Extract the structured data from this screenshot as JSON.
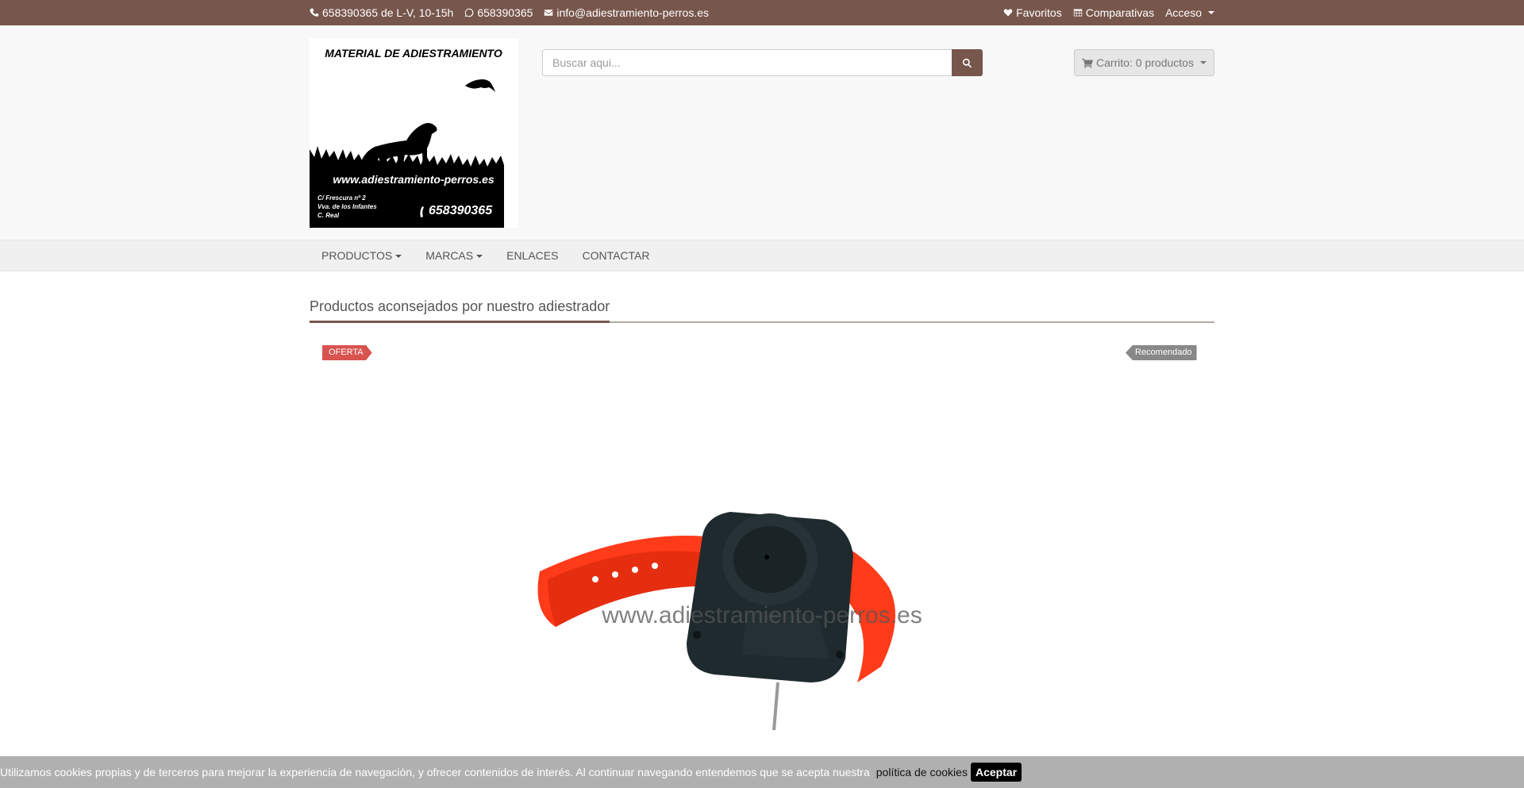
{
  "topbar": {
    "phone": "658390365 de L-V, 10-15h",
    "whatsapp": "658390365",
    "email": "info@adiestramiento-perros.es",
    "favorites": "Favoritos",
    "comparisons": "Comparativas",
    "access": "Acceso"
  },
  "logo": {
    "title": "MATERIAL DE ADIESTRAMIENTO",
    "website": "www.adiestramiento-perros.es",
    "address_line1": "C/ Frescura nº 2",
    "address_line2": "Vva. de los Infantes",
    "address_line3": "C. Real",
    "phone": "658390365"
  },
  "search": {
    "placeholder": "Buscar aqui..."
  },
  "cart": {
    "label": "Carrito: 0 productos"
  },
  "nav": {
    "items": [
      {
        "label": "PRODUCTOS",
        "dropdown": true
      },
      {
        "label": "MARCAS",
        "dropdown": true
      },
      {
        "label": "ENLACES",
        "dropdown": false
      },
      {
        "label": "CONTACTAR",
        "dropdown": false
      }
    ]
  },
  "section": {
    "title": "Productos aconsejados por nuestro adiestrador"
  },
  "product": {
    "badge_offer": "OFERTA",
    "badge_recommended": "Recomendado",
    "watermark": "www.adiestramiento-perros.es"
  },
  "cookie": {
    "text": "Utilizamos cookies propias y de terceros para mejorar la experiencia de navegación, y ofrecer contenidos de interés. Al continuar navegando entendemos que se acepta nuestra",
    "link": "política de cookies",
    "accept": "Aceptar"
  },
  "colors": {
    "brand": "#77564c",
    "offer": "#d9534f",
    "recommended": "#888888",
    "collar": "#ff3b1a"
  }
}
